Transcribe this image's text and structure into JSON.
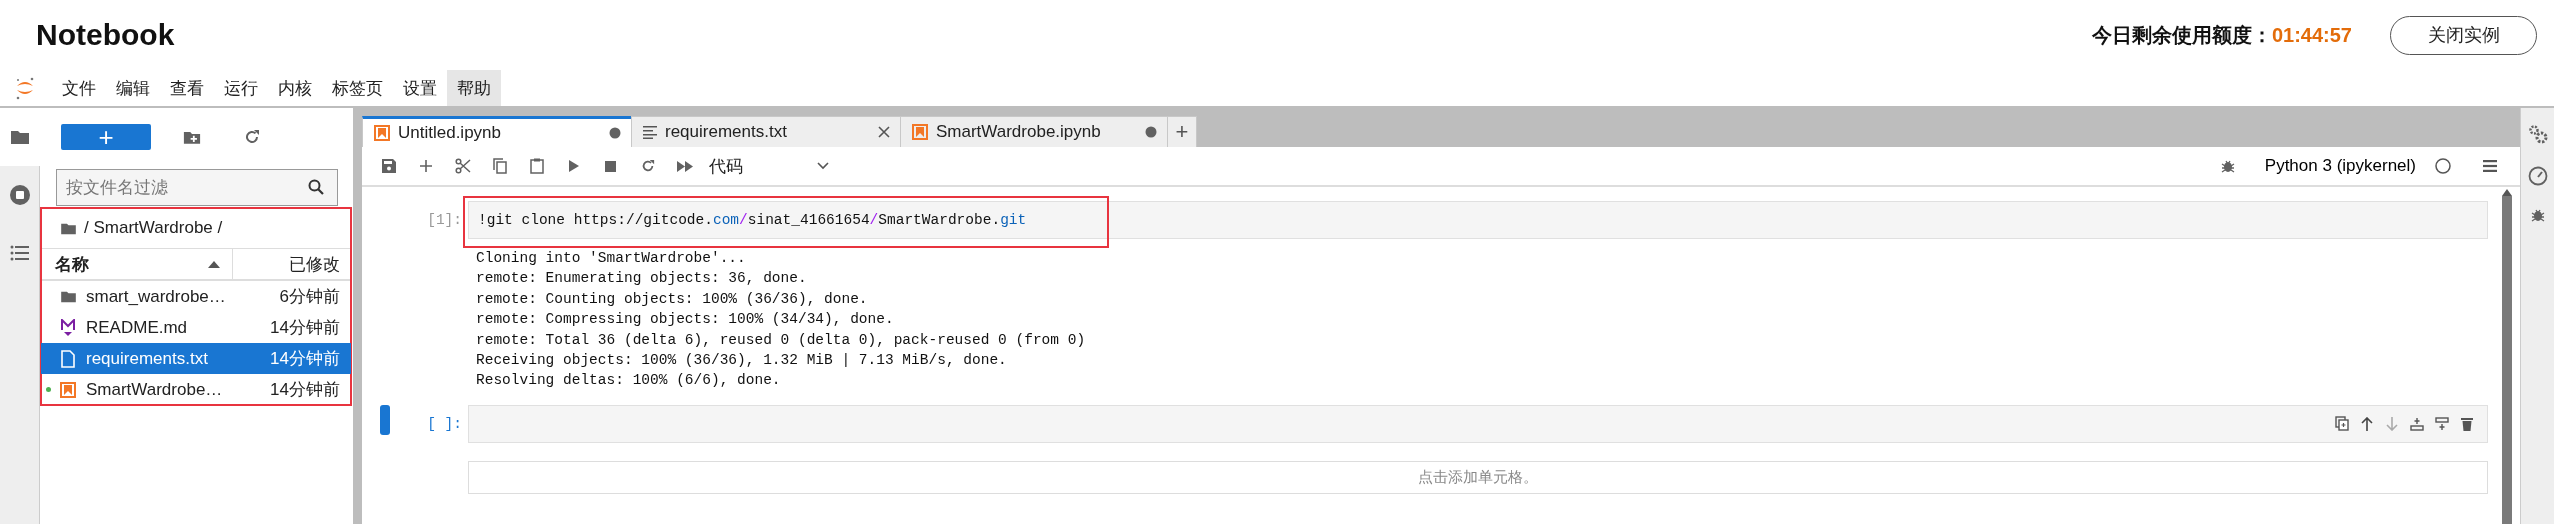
{
  "header": {
    "title": "Notebook",
    "quota_label": "今日剩余使用额度：",
    "quota_time": "01:44:57",
    "close_button": "关闭实例"
  },
  "menu": [
    {
      "label": "文件",
      "selected": false
    },
    {
      "label": "编辑",
      "selected": false
    },
    {
      "label": "查看",
      "selected": false
    },
    {
      "label": "运行",
      "selected": false
    },
    {
      "label": "内核",
      "selected": false
    },
    {
      "label": "标签页",
      "selected": false
    },
    {
      "label": "设置",
      "selected": false
    },
    {
      "label": "帮助",
      "selected": true
    }
  ],
  "left_strip": [
    {
      "kind": "folder",
      "selected": true
    },
    {
      "kind": "running",
      "selected": false
    },
    {
      "kind": "toc",
      "selected": false
    }
  ],
  "file_browser": {
    "new_button": "+",
    "filter_placeholder": "按文件名过滤",
    "path": "/ SmartWardrobe /",
    "highlighted": true,
    "columns": [
      {
        "label": "名称",
        "sorted": true
      },
      {
        "label": "已修改",
        "sorted": false
      }
    ],
    "files": [
      {
        "kind": "folder",
        "name": "smart_wardrobe…",
        "modified": "6分钟前",
        "selected": false,
        "running": false
      },
      {
        "kind": "markdown",
        "name": "README.md",
        "modified": "14分钟前",
        "selected": false,
        "running": false
      },
      {
        "kind": "text",
        "name": "requirements.txt",
        "modified": "14分钟前",
        "selected": true,
        "running": false
      },
      {
        "kind": "notebook",
        "name": "SmartWardrobe…",
        "modified": "14分钟前",
        "selected": false,
        "running": true
      }
    ]
  },
  "tabs": [
    {
      "kind": "notebook",
      "label": "Untitled.ipynb",
      "selected": true,
      "dirty": true
    },
    {
      "kind": "text",
      "label": "requirements.txt",
      "selected": false,
      "dirty": false
    },
    {
      "kind": "notebook",
      "label": "SmartWardrobe.ipynb",
      "selected": false,
      "dirty": true
    }
  ],
  "add_tab": "+",
  "toolbar": {
    "cell_type": "代码",
    "kernel": "Python 3 (ipykernel)"
  },
  "cells": [
    {
      "prompt": "[1]:",
      "active": false,
      "highlighted": true,
      "source": [
        {
          "kind": "plain",
          "text": "!git clone https://gitcode."
        },
        {
          "kind": "attr",
          "text": "com"
        },
        {
          "kind": "op",
          "text": "/"
        },
        {
          "kind": "plain",
          "text": "sinat_41661654"
        },
        {
          "kind": "op",
          "text": "/"
        },
        {
          "kind": "plain",
          "text": "SmartWardrobe."
        },
        {
          "kind": "attr",
          "text": "git"
        }
      ],
      "output": [
        "Cloning into 'SmartWardrobe'...",
        "remote: Enumerating objects: 36, done.",
        "remote: Counting objects: 100% (36/36), done.",
        "remote: Compressing objects: 100% (34/34), done.",
        "remote: Total 36 (delta 6), reused 0 (delta 0), pack-reused 0 (from 0)",
        "Receiving objects: 100% (36/36), 1.32 MiB | 7.13 MiB/s, done.",
        "Resolving deltas: 100% (6/6), done."
      ]
    },
    {
      "prompt": "[ ]:",
      "active": true,
      "highlighted": false
    }
  ],
  "add_cell": "点击添加单元格。"
}
